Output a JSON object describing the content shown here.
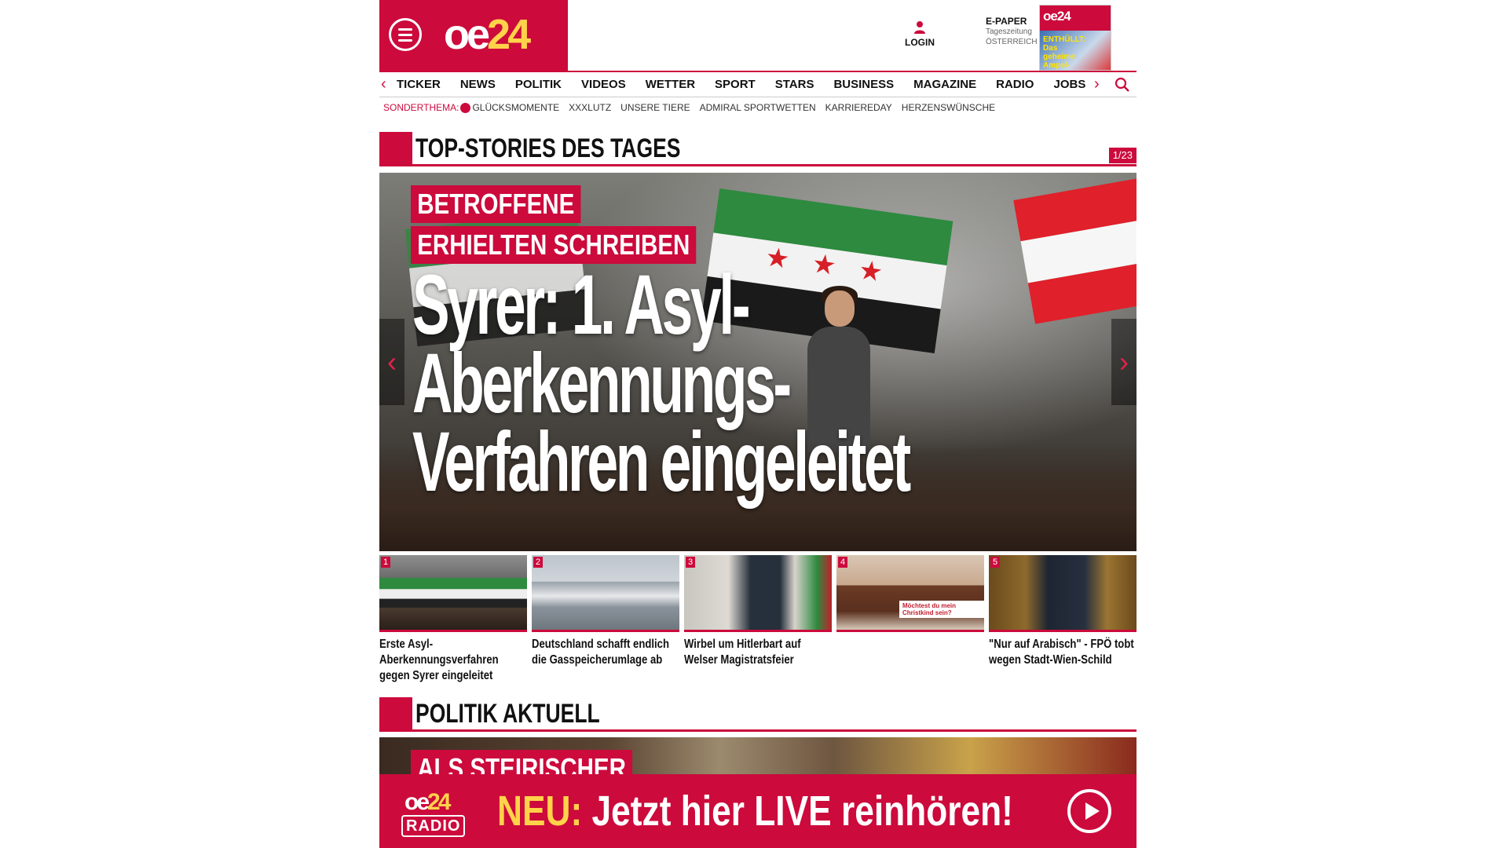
{
  "header": {
    "logo_main": "oe",
    "logo_num": "24",
    "login_label": "LOGIN",
    "epaper_title": "E-PAPER",
    "epaper_sub1": "Tageszeitung",
    "epaper_sub2": "ÖSTERREICH",
    "epaper_cover_logo": "oe24",
    "epaper_cover_headline": "ENTHÜLLT: Das geheime Ampel-Papier"
  },
  "nav": {
    "items": [
      "TICKER",
      "NEWS",
      "POLITIK",
      "VIDEOS",
      "WETTER",
      "SPORT",
      "STARS",
      "BUSINESS",
      "MAGAZINE",
      "RADIO",
      "JOBS"
    ],
    "prev_glyph": "‹",
    "next_glyph": "›"
  },
  "subnav": {
    "label": "SONDERTHEMA:",
    "items": [
      "GLÜCKSMOMENTE",
      "XXXLUTZ",
      "UNSERE TIERE",
      "ADMIRAL SPORTWETTEN",
      "KARRIEREDAY",
      "HERZENSWÜNSCHE"
    ]
  },
  "top_stories": {
    "section_title": "TOP-STORIES DES TAGES",
    "counter": "1/23",
    "hero": {
      "kicker_line1": "BETROFFENE",
      "kicker_line2": "ERHIELTEN SCHREIBEN",
      "title": "Syrer: 1. Asyl-Aberkennungs-Verfahren eingeleitet"
    },
    "thumbs": [
      {
        "num": "1",
        "caption": "Erste Asyl-Aberkennungsverfahren gegen Syrer eingeleitet"
      },
      {
        "num": "2",
        "caption": "Deutschland schafft endlich die Gasspeicherumlage ab"
      },
      {
        "num": "3",
        "caption": "Wirbel um Hitlerbart auf Welser Magistratsfeier"
      },
      {
        "num": "4",
        "caption": "",
        "tag": "Möchtest du mein Christkind sein?"
      },
      {
        "num": "5",
        "caption": "\"Nur auf Arabisch\" - FPÖ tobt wegen Stadt-Wien-Schild"
      }
    ]
  },
  "politik": {
    "section_title": "POLITIK AKTUELL",
    "kicker": "ALS STEIRISCHER"
  },
  "radio_banner": {
    "logo_main": "oe",
    "logo_num": "24",
    "logo_sub": "RADIO",
    "neu": "NEU:",
    "text": "Jetzt hier LIVE reinhören!"
  },
  "colors": {
    "brand_red": "#cc0a3c",
    "accent_yellow": "#ffd24a"
  }
}
